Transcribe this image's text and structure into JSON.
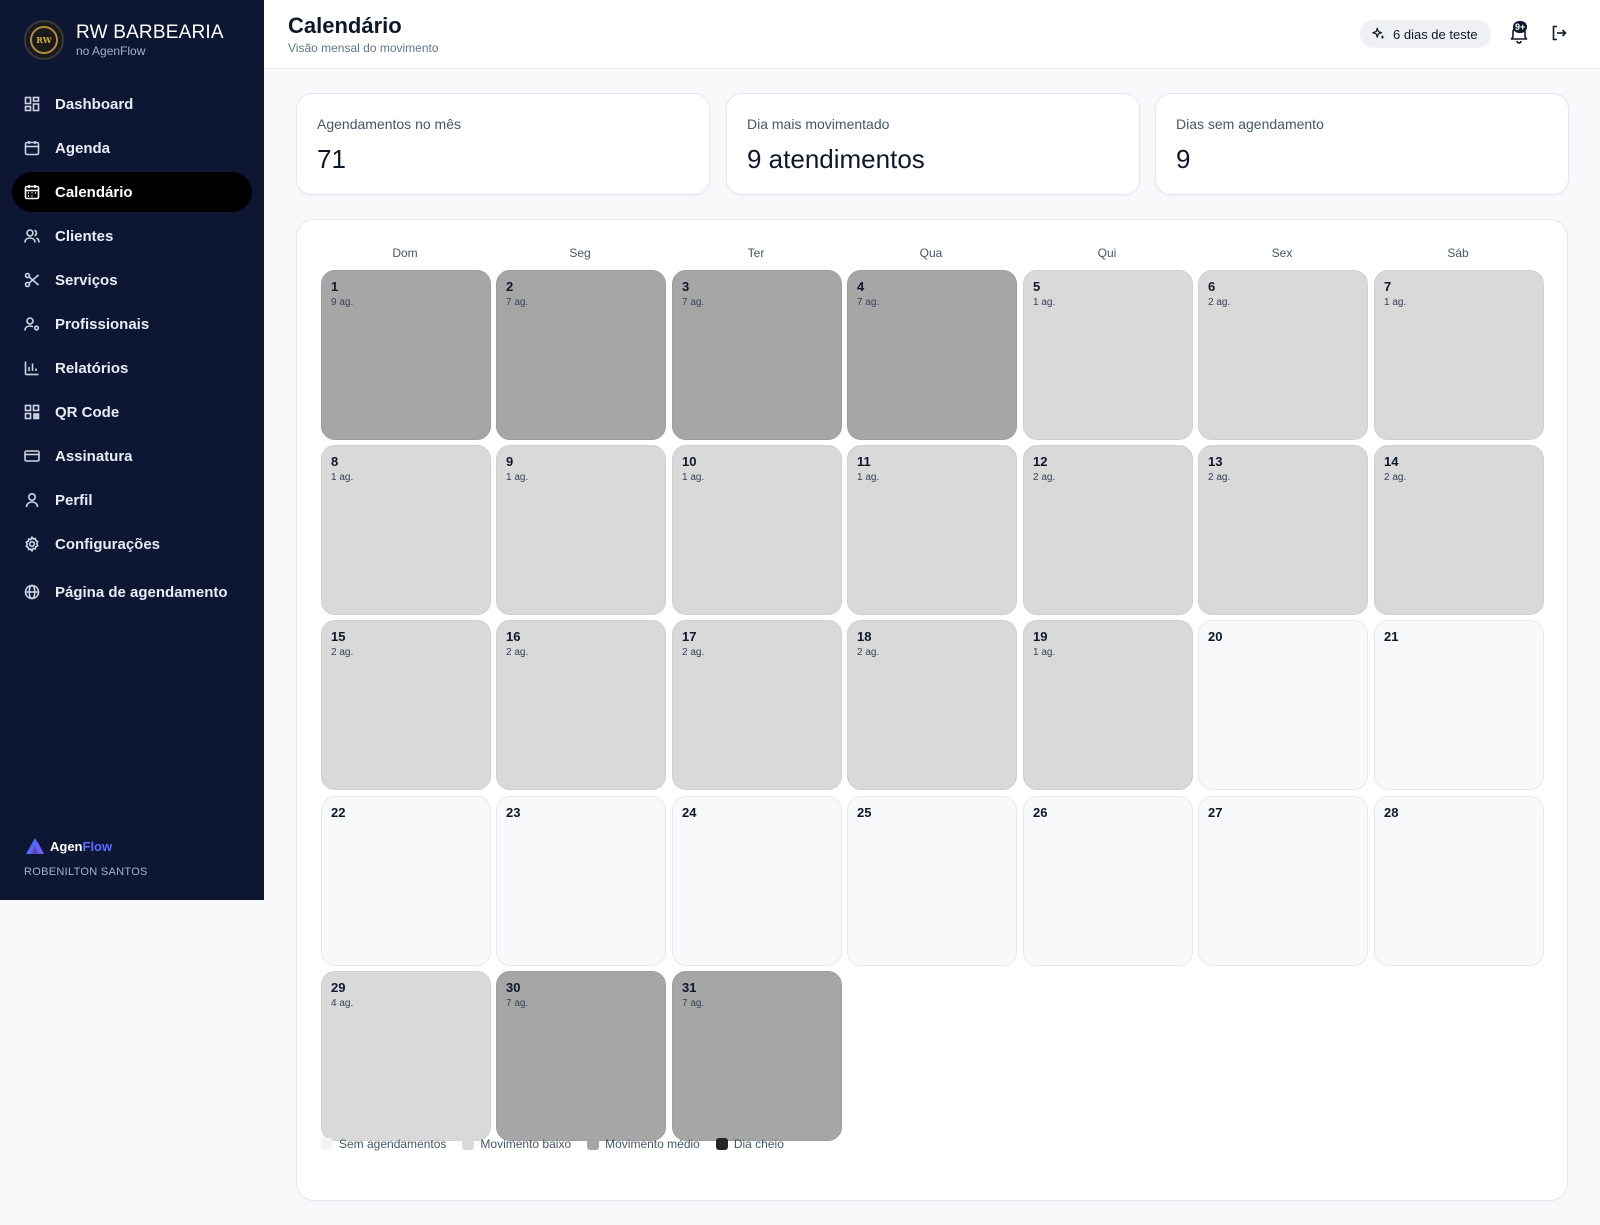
{
  "brand": {
    "name": "RW BARBEARIA",
    "subtitle": "no AgenFlow",
    "logo_text": "RW"
  },
  "nav": [
    {
      "label": "Dashboard",
      "icon": "dashboard-icon"
    },
    {
      "label": "Agenda",
      "icon": "calendar-icon"
    },
    {
      "label": "Calendário",
      "icon": "calendar-days-icon",
      "active": true
    },
    {
      "label": "Clientes",
      "icon": "users-icon"
    },
    {
      "label": "Serviços",
      "icon": "scissors-icon"
    },
    {
      "label": "Profissionais",
      "icon": "user-cog-icon"
    },
    {
      "label": "Relatórios",
      "icon": "bar-chart-icon"
    },
    {
      "label": "QR Code",
      "icon": "qr-code-icon"
    },
    {
      "label": "Assinatura",
      "icon": "credit-card-icon"
    },
    {
      "label": "Perfil",
      "icon": "user-icon"
    },
    {
      "label": "Configurações",
      "icon": "gear-icon"
    },
    {
      "label": "Página de agendamento",
      "icon": "globe-icon"
    }
  ],
  "footer": {
    "logo_main": "Agen",
    "logo_accent": "Flow",
    "user": "ROBENILTON SANTOS"
  },
  "header": {
    "title": "Calendário",
    "subtitle": "Visão mensal do movimento",
    "trial": "6 dias de teste",
    "notif_badge": "9+"
  },
  "stats": [
    {
      "label": "Agendamentos no mês",
      "value": "71"
    },
    {
      "label": "Dia mais movimentado",
      "value": "9 atendimentos"
    },
    {
      "label": "Dias sem agendamento",
      "value": "9"
    }
  ],
  "calendar": {
    "weekdays": [
      "Dom",
      "Seg",
      "Ter",
      "Qua",
      "Qui",
      "Sex",
      "Sáb"
    ],
    "days": [
      {
        "day": "1",
        "count": "9 ag.",
        "level": "mid"
      },
      {
        "day": "2",
        "count": "7 ag.",
        "level": "mid"
      },
      {
        "day": "3",
        "count": "7 ag.",
        "level": "mid"
      },
      {
        "day": "4",
        "count": "7 ag.",
        "level": "mid"
      },
      {
        "day": "5",
        "count": "1 ag.",
        "level": "low"
      },
      {
        "day": "6",
        "count": "2 ag.",
        "level": "low"
      },
      {
        "day": "7",
        "count": "1 ag.",
        "level": "low"
      },
      {
        "day": "8",
        "count": "1 ag.",
        "level": "low"
      },
      {
        "day": "9",
        "count": "1 ag.",
        "level": "low"
      },
      {
        "day": "10",
        "count": "1 ag.",
        "level": "low"
      },
      {
        "day": "11",
        "count": "1 ag.",
        "level": "low"
      },
      {
        "day": "12",
        "count": "2 ag.",
        "level": "low"
      },
      {
        "day": "13",
        "count": "2 ag.",
        "level": "low"
      },
      {
        "day": "14",
        "count": "2 ag.",
        "level": "low"
      },
      {
        "day": "15",
        "count": "2 ag.",
        "level": "low"
      },
      {
        "day": "16",
        "count": "2 ag.",
        "level": "low"
      },
      {
        "day": "17",
        "count": "2 ag.",
        "level": "low"
      },
      {
        "day": "18",
        "count": "2 ag.",
        "level": "low"
      },
      {
        "day": "19",
        "count": "1 ag.",
        "level": "low"
      },
      {
        "day": "20",
        "count": "",
        "level": "none"
      },
      {
        "day": "21",
        "count": "",
        "level": "none"
      },
      {
        "day": "22",
        "count": "",
        "level": "none"
      },
      {
        "day": "23",
        "count": "",
        "level": "none"
      },
      {
        "day": "24",
        "count": "",
        "level": "none"
      },
      {
        "day": "25",
        "count": "",
        "level": "none"
      },
      {
        "day": "26",
        "count": "",
        "level": "none"
      },
      {
        "day": "27",
        "count": "",
        "level": "none"
      },
      {
        "day": "28",
        "count": "",
        "level": "none"
      },
      {
        "day": "29",
        "count": "4 ag.",
        "level": "low"
      },
      {
        "day": "30",
        "count": "7 ag.",
        "level": "mid"
      },
      {
        "day": "31",
        "count": "7 ag.",
        "level": "mid"
      }
    ],
    "legend": [
      {
        "label": "Sem agendamentos",
        "color": "#f3f4f6"
      },
      {
        "label": "Movimento baixo",
        "color": "#d9d9d9"
      },
      {
        "label": "Movimento médio",
        "color": "#a6a6a6"
      },
      {
        "label": "Dia cheio",
        "color": "#262626"
      }
    ]
  }
}
